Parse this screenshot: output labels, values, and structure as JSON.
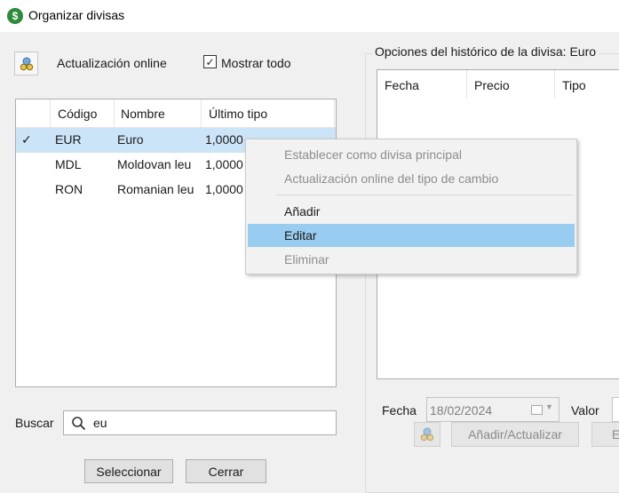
{
  "window": {
    "title": "Organizar divisas",
    "icon": "dollar-icon"
  },
  "toolbar": {
    "online_update_label": "Actualización online",
    "show_all_label": "Mostrar todo",
    "show_all_checked": true,
    "check_glyph": "✓"
  },
  "currency_table": {
    "columns": [
      "Código",
      "Nombre",
      "Último tipo"
    ],
    "rows": [
      {
        "mark": "✓",
        "code": "EUR",
        "name": "Euro",
        "rate": "1,0000",
        "selected": true
      },
      {
        "mark": "",
        "code": "MDL",
        "name": "Moldovan leu",
        "rate": "1,0000",
        "selected": false
      },
      {
        "mark": "",
        "code": "RON",
        "name": "Romanian leu",
        "rate": "1,0000",
        "selected": false
      }
    ]
  },
  "search": {
    "label": "Buscar",
    "value": "eu"
  },
  "buttons": {
    "select": "Seleccionar",
    "close": "Cerrar"
  },
  "history": {
    "group_title": "Opciones del histórico de la divisa: Euro",
    "columns": [
      "Fecha",
      "Precio",
      "Tipo"
    ],
    "date_label": "Fecha",
    "date_value": "18/02/2024",
    "value_label": "Valor",
    "add_update_button": "Añadir/Actualizar",
    "truncated_button": "E"
  },
  "context_menu": {
    "items": [
      {
        "label": "Establecer como divisa principal",
        "enabled": false
      },
      {
        "label": "Actualización online del tipo de cambio",
        "enabled": false
      },
      {
        "label": "Añadir",
        "enabled": true
      },
      {
        "label": "Editar",
        "enabled": true,
        "highlighted": true
      },
      {
        "label": "Eliminar",
        "enabled": false
      }
    ]
  },
  "colors": {
    "selection": "#cce4f7",
    "menu_highlight": "#99ccf1",
    "window_bg": "#f0f0f0"
  }
}
